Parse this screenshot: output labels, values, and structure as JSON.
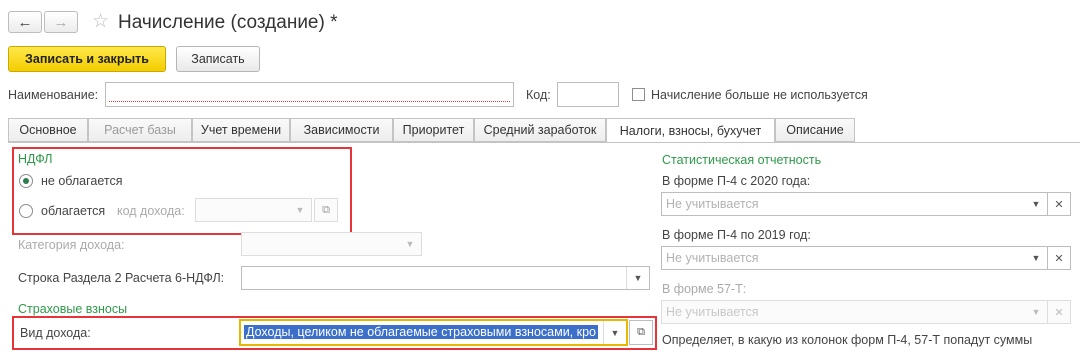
{
  "window": {
    "title": "Начисление (создание) *"
  },
  "toolbar": {
    "save_close": "Записать и закрыть",
    "save": "Записать"
  },
  "header": {
    "name_label": "Наименование:",
    "name_value": "",
    "code_label": "Код:",
    "code_value": "",
    "unused_label": "Начисление больше не используется"
  },
  "tabs": [
    {
      "label": "Основное"
    },
    {
      "label": "Расчет базы"
    },
    {
      "label": "Учет времени"
    },
    {
      "label": "Зависимости"
    },
    {
      "label": "Приоритет"
    },
    {
      "label": "Средний заработок"
    },
    {
      "label": "Налоги, взносы, бухучет"
    },
    {
      "label": "Описание"
    }
  ],
  "ndfl": {
    "group_title": "НДФЛ",
    "opt_not_taxed": "не облагается",
    "opt_taxed": "облагается",
    "income_code_label": "код дохода:",
    "income_category_label": "Категория дохода:",
    "section_row_label": "Строка Раздела 2 Расчета 6-НДФЛ:"
  },
  "insurance": {
    "group_title": "Страховые взносы",
    "income_type_label": "Вид дохода:",
    "income_type_value": "Доходы, целиком не облагаемые страховыми взносами, кро"
  },
  "stats": {
    "group_title": "Статистическая отчетность",
    "p4_2020_label": "В форме П-4 с 2020 года:",
    "p4_2020_placeholder": "Не учитывается",
    "p4_2019_label": "В форме П-4 по 2019 год:",
    "p4_2019_placeholder": "Не учитывается",
    "f57t_label": "В форме 57-Т:",
    "f57t_placeholder": "Не учитывается",
    "note": "Определяет, в какую из колонок форм П-4, 57-Т попадут суммы"
  }
}
